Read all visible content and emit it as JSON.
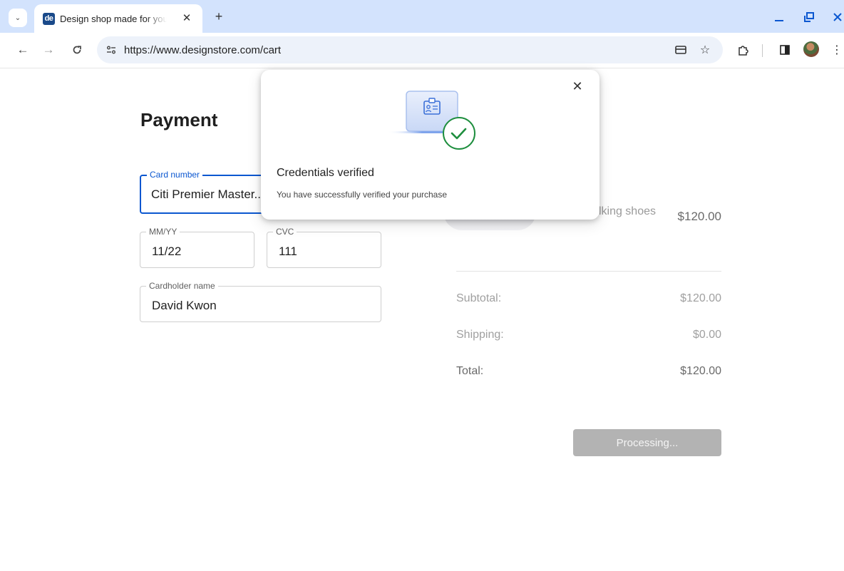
{
  "browser": {
    "tab": {
      "favicon_text": "de",
      "title": "Design shop made for you"
    },
    "url": "https://www.designstore.com/cart",
    "colors": {
      "tabstrip": "#d3e3fd",
      "accent": "#0b57d0"
    }
  },
  "payment": {
    "title": "Payment",
    "card_number": {
      "label": "Card number",
      "value": "Citi Premier Master..."
    },
    "expiry": {
      "label": "MM/YY",
      "value": "11/22"
    },
    "cvc": {
      "label": "CVC",
      "value": "111"
    },
    "cardholder": {
      "label": "Cardholder name",
      "value": "David Kwon"
    }
  },
  "summary": {
    "product_name": "walking shoes",
    "product_price": "$120.00",
    "subtotal_label": "Subtotal:",
    "subtotal_value": "$120.00",
    "shipping_label": "Shipping:",
    "shipping_value": "$0.00",
    "total_label": "Total:",
    "total_value": "$120.00",
    "button_label": "Processing..."
  },
  "dialog": {
    "title": "Credentials verified",
    "description": "You have successfully verified your purchase",
    "icon": "laptop-id-badge-with-green-checkmark",
    "check_color": "#1e8e3e"
  }
}
